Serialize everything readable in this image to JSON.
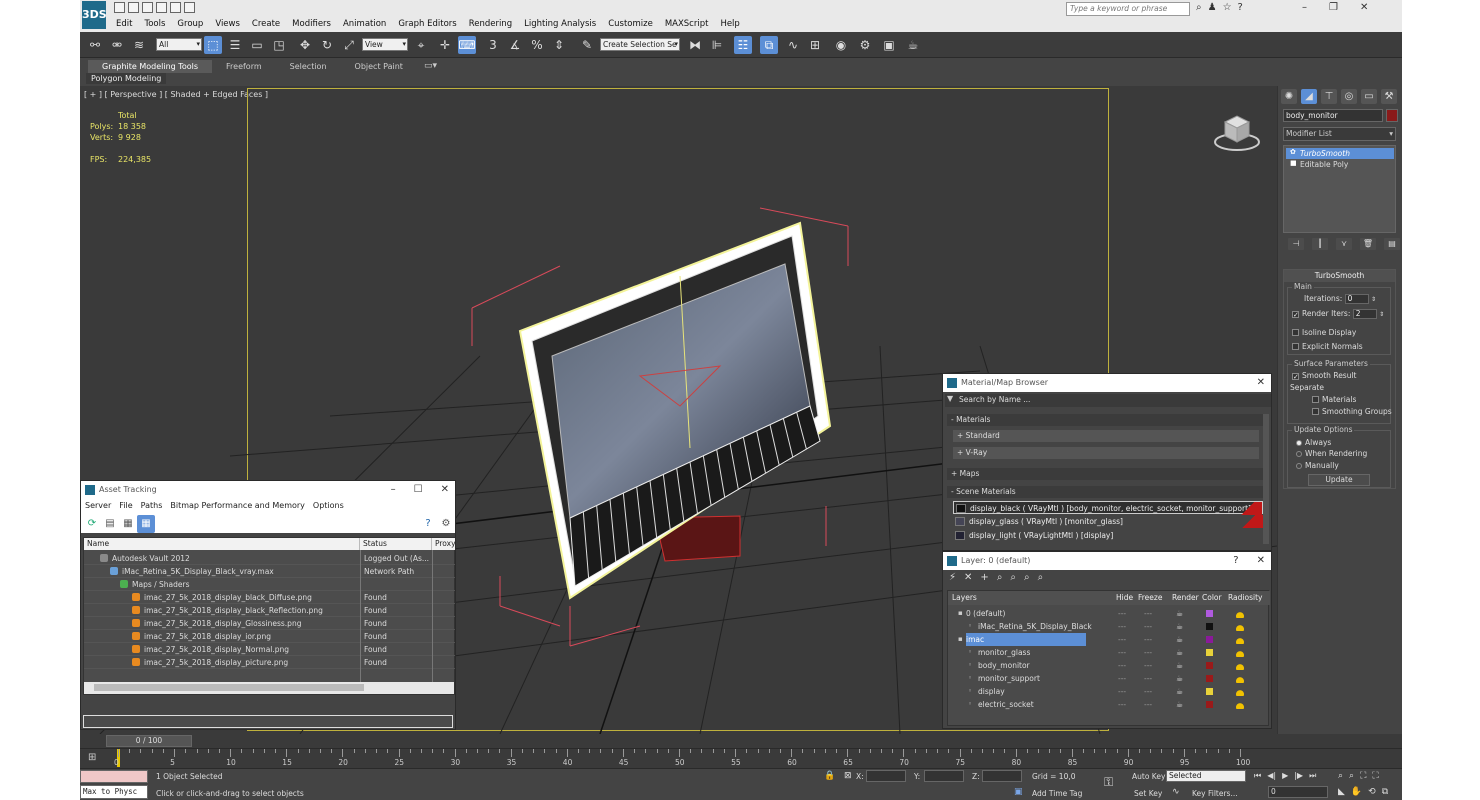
{
  "app": {
    "logo_text": "3DS",
    "menus": [
      "Edit",
      "Tools",
      "Group",
      "Views",
      "Create",
      "Modifiers",
      "Animation",
      "Graph Editors",
      "Rendering",
      "Lighting Analysis",
      "Customize",
      "MAXScript",
      "Help"
    ],
    "search_placeholder": "Type a keyword or phrase"
  },
  "toolbar": {
    "selection_filter": "All",
    "ref_coord": "View",
    "named_selection": "Create Selection Se"
  },
  "ribbon": {
    "tabs": [
      "Graphite Modeling Tools",
      "Freeform",
      "Selection",
      "Object Paint"
    ],
    "subtab": "Polygon Modeling"
  },
  "viewport": {
    "label": "[ + ] [ Perspective ] [ Shaded + Edged Faces ]",
    "stats": {
      "total_label": "Total",
      "polys_label": "Polys:",
      "polys_value": "18 358",
      "verts_label": "Verts:",
      "verts_value": "9 928",
      "fps_label": "FPS:",
      "fps_value": "224,385"
    }
  },
  "command_panel": {
    "object_name": "body_monitor",
    "object_color": "#8a1a1a",
    "modifier_list": "Modifier List",
    "stack": [
      "TurboSmooth",
      "Editable Poly"
    ],
    "rollout_title": "TurboSmooth",
    "main_group": "Main",
    "iterations_label": "Iterations:",
    "iterations_value": "0",
    "render_iters_label": "Render Iters:",
    "render_iters_value": "2",
    "isoline_display": "Isoline Display",
    "explicit_normals": "Explicit Normals",
    "surface_group": "Surface Parameters",
    "smooth_result": "Smooth Result",
    "separate_label": "Separate",
    "materials": "Materials",
    "smoothing_groups": "Smoothing Groups",
    "update_group": "Update Options",
    "always": "Always",
    "when_rendering": "When Rendering",
    "manually": "Manually",
    "update_button": "Update"
  },
  "asset_tracking": {
    "title": "Asset Tracking",
    "menus": [
      "Server",
      "File",
      "Paths",
      "Bitmap Performance and Memory",
      "Options"
    ],
    "columns": [
      "Name",
      "Status",
      "Proxy"
    ],
    "rows": [
      {
        "name": "Autodesk Vault 2012",
        "status": "Logged Out (As..."
      },
      {
        "name": "iMac_Retina_5K_Display_Black_vray.max",
        "status": "Network Path"
      },
      {
        "name": "Maps / Shaders",
        "status": ""
      },
      {
        "name": "imac_27_5k_2018_display_black_Diffuse.png",
        "status": "Found"
      },
      {
        "name": "imac_27_5k_2018_display_black_Reflection.png",
        "status": "Found"
      },
      {
        "name": "imac_27_5k_2018_display_Glossiness.png",
        "status": "Found"
      },
      {
        "name": "imac_27_5k_2018_display_ior.png",
        "status": "Found"
      },
      {
        "name": "imac_27_5k_2018_display_Normal.png",
        "status": "Found"
      },
      {
        "name": "imac_27_5k_2018_display_picture.png",
        "status": "Found"
      }
    ]
  },
  "material_browser": {
    "title": "Material/Map Browser",
    "search_placeholder": "Search by Name ...",
    "sections": [
      "- Materials",
      "+ Maps",
      "- Scene Materials"
    ],
    "material_groups": [
      "+ Standard",
      "+ V-Ray"
    ],
    "scene_materials": [
      "display_black  ( VRayMtl ) [body_monitor, electric_socket, monitor_support]",
      "display_glass  ( VRayMtl ) [monitor_glass]",
      "display_light  ( VRayLightMtl ) [display]"
    ]
  },
  "layer_manager": {
    "title": "Layer: 0 (default)",
    "help": "?",
    "columns": [
      "Layers",
      "Hide",
      "Freeze",
      "Render",
      "Color",
      "Radiosity"
    ],
    "rows": [
      {
        "name": "0 (default)",
        "indent": 1,
        "color": "#b05adf"
      },
      {
        "name": "iMac_Retina_5K_Display_Black",
        "indent": 2,
        "color": "#111111"
      },
      {
        "name": "imac",
        "indent": 1,
        "color": "#8a1a9a",
        "selected": true
      },
      {
        "name": "monitor_glass",
        "indent": 2,
        "color": "#e8d23a"
      },
      {
        "name": "body_monitor",
        "indent": 2,
        "color": "#9a1a1a"
      },
      {
        "name": "monitor_support",
        "indent": 2,
        "color": "#9a1a1a"
      },
      {
        "name": "display",
        "indent": 2,
        "color": "#e8d23a"
      },
      {
        "name": "electric_socket",
        "indent": 2,
        "color": "#9a1a1a"
      }
    ]
  },
  "timeline": {
    "slider": "0 / 100",
    "ticks": [
      "0",
      "5",
      "10",
      "15",
      "20",
      "25",
      "30",
      "35",
      "40",
      "45",
      "50",
      "55",
      "60",
      "65",
      "70",
      "75",
      "80",
      "85",
      "90",
      "95",
      "100"
    ]
  },
  "status": {
    "maxscript": "Max to Physc",
    "selected": "1 Object Selected",
    "prompt": "Click or click-and-drag to select objects",
    "x_label": "X:",
    "y_label": "Y:",
    "z_label": "Z:",
    "grid": "Grid = 10,0",
    "add_time_tag": "Add Time Tag",
    "auto_key": "Auto Key",
    "set_key": "Set Key",
    "key_mode": "Selected",
    "key_filters": "Key Filters...",
    "frame": "0"
  }
}
